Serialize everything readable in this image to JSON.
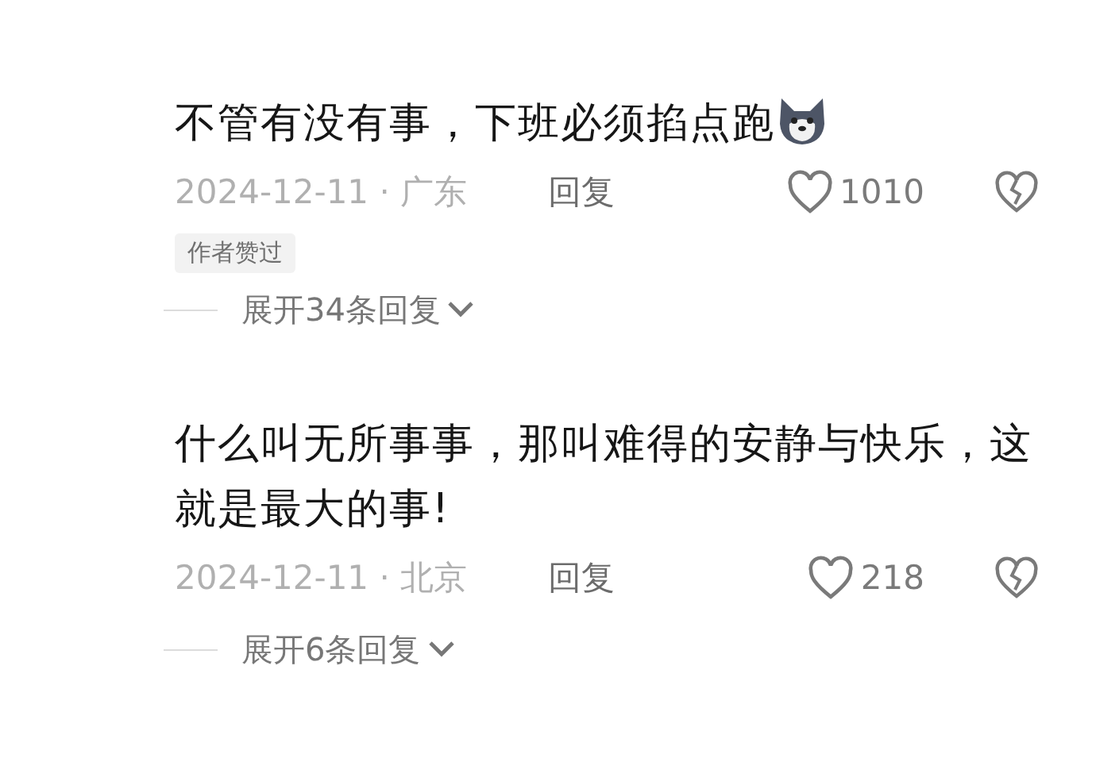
{
  "comments": [
    {
      "text": "不管有没有事，下班必须掐点跑",
      "emoji": true,
      "date": "2024-12-11",
      "separator": "·",
      "location": "广东",
      "reply": "回复",
      "likes": "1010",
      "badge": "作者赞过",
      "expand": "展开34条回复"
    },
    {
      "text": "什么叫无所事事，那叫难得的安静与快乐，这就是最大的事!",
      "emoji": false,
      "date": "2024-12-11",
      "separator": "·",
      "location": "北京",
      "reply": "回复",
      "likes": "218",
      "expand": "展开6条回复"
    }
  ]
}
